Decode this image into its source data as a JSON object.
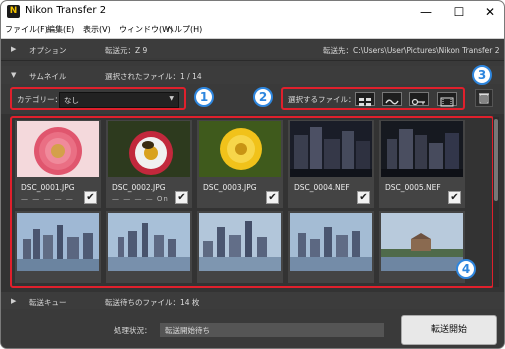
{
  "window": {
    "title": "Nikon Transfer 2",
    "minimize": "—",
    "maximize": "☐",
    "close": "✕"
  },
  "menu": [
    "ファイル(F)",
    "編集(E)",
    "表示(V)",
    "ウィンドウ(W)",
    "ヘルプ(H)"
  ],
  "options": {
    "label": "オプション",
    "source": "転送元：Z 9",
    "destination": "転送先：C:\\Users\\User\\Pictures\\Nikon Transfer 2"
  },
  "thumbnails_section": {
    "label": "サムネイル",
    "selected": "選択されたファイル：1 / 14"
  },
  "toolbar": {
    "category_label": "カテゴリー：",
    "category_value": "なし",
    "select_files_label": "選択するファイル：",
    "select_buttons": [
      "select-all-icon",
      "rotate-icon",
      "protected-key-icon",
      "film-strip-icon"
    ]
  },
  "badges": [
    "1",
    "2",
    "3",
    "4"
  ],
  "files": [
    {
      "name": "DSC_0001.JPG",
      "checked": true,
      "marks": "— — — — —"
    },
    {
      "name": "DSC_0002.JPG",
      "checked": true,
      "marks": "— — — — On"
    },
    {
      "name": "DSC_0003.JPG",
      "checked": true,
      "marks": ""
    },
    {
      "name": "DSC_0004.NEF",
      "checked": true,
      "marks": ""
    },
    {
      "name": "DSC_0005.NEF",
      "checked": true,
      "marks": ""
    }
  ],
  "queue": {
    "label": "転送キュー",
    "waiting": "転送待ちのファイル：14 枚"
  },
  "bottom": {
    "status_label": "処理状況：",
    "status_value": "転送開始待ち",
    "start_button": "転送開始"
  },
  "colors": {
    "highlight_red": "#e0202c",
    "badge_blue": "#2e86de",
    "background": "#3a3a3a"
  }
}
